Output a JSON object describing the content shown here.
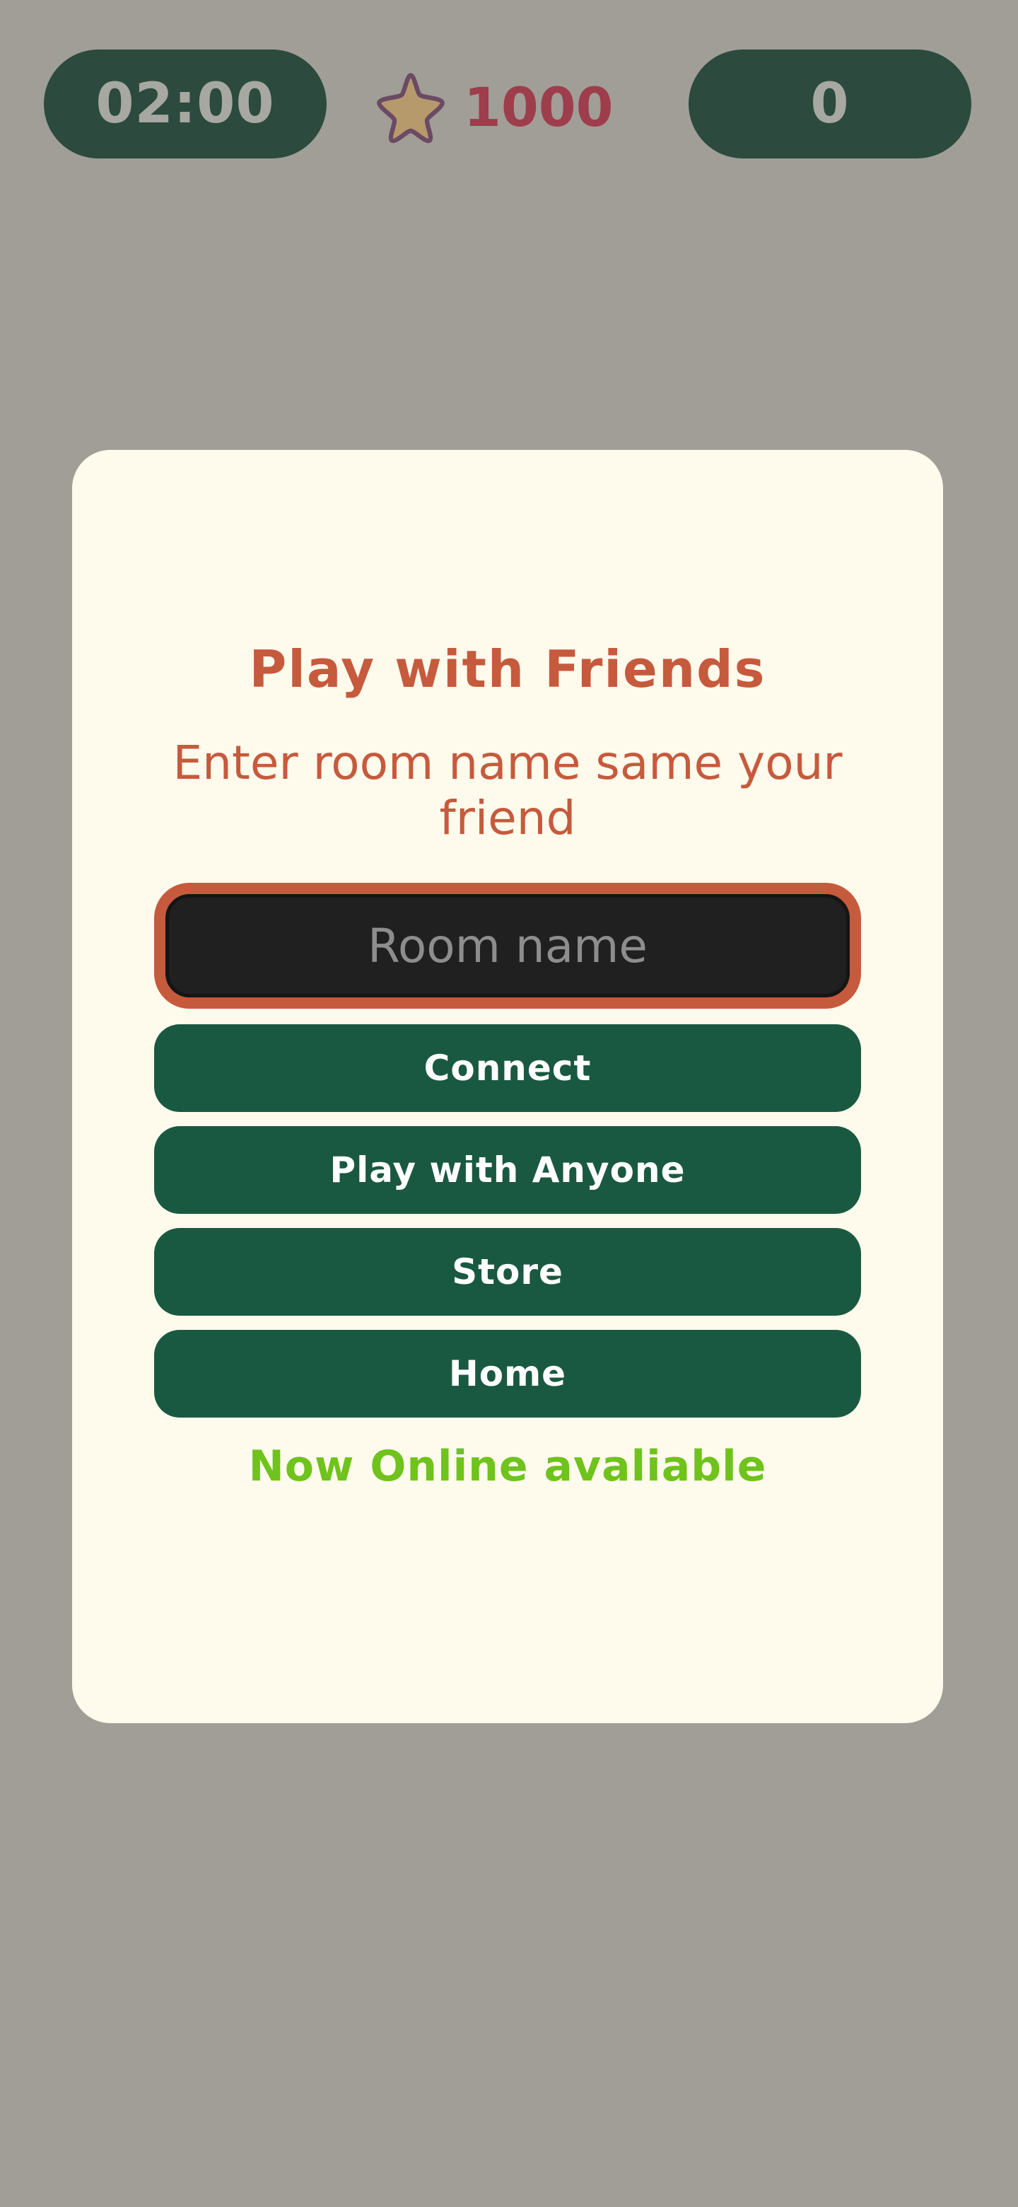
{
  "hud": {
    "timer": "02:00",
    "coins": "1000",
    "coin_icon": "star-icon",
    "score": "0"
  },
  "modal": {
    "title": "Play with Friends",
    "subtitle": "Enter room name same your friend",
    "room_input": {
      "value": "",
      "placeholder": "Room name"
    },
    "buttons": {
      "connect": "Connect",
      "play_anyone": "Play with Anyone",
      "store": "Store",
      "home": "Home"
    },
    "status": "Now Online avaliable"
  },
  "colors": {
    "background": "#a09e97",
    "hud_pill": "#2c4a3e",
    "coin_text": "#9e3d4b",
    "star_fill": "#b69a6c",
    "star_outline": "#6b4a64",
    "card": "#fefaec",
    "accent": "#c65a3d",
    "button": "#1a5941",
    "status": "#6fc31c"
  }
}
